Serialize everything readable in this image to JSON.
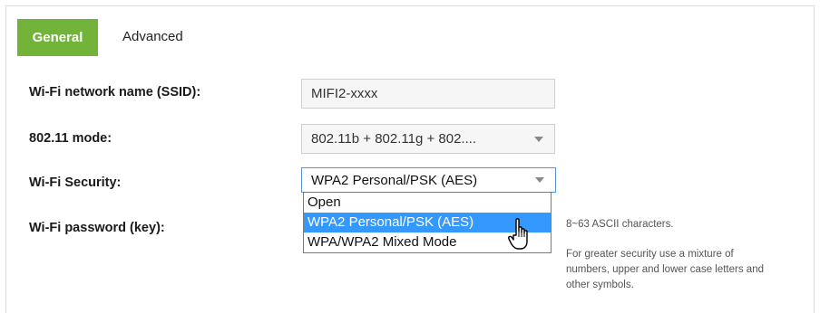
{
  "tabs": [
    {
      "label": "General",
      "active": true
    },
    {
      "label": "Advanced",
      "active": false
    }
  ],
  "fields": {
    "ssid": {
      "label": "Wi-Fi network name (SSID):",
      "value": "MIFI2-xxxx"
    },
    "mode": {
      "label": "802.11 mode:",
      "value": "802.11b + 802.11g + 802...."
    },
    "security": {
      "label": "Wi-Fi Security:",
      "value": "WPA2 Personal/PSK (AES)",
      "options": [
        "Open",
        "WPA2 Personal/PSK (AES)",
        "WPA/WPA2 Mixed Mode"
      ],
      "highlighted": "WPA2 Personal/PSK (AES)"
    },
    "password": {
      "label": "Wi-Fi password (key):"
    }
  },
  "help": {
    "line1": "8~63 ASCII characters.",
    "line2": "For greater security use a mixture of",
    "line3": "numbers, upper and lower case letters and",
    "line4": "other symbols."
  },
  "colors": {
    "accent": "#72b33a",
    "highlight": "#3399ff"
  },
  "icons": {
    "cursor": "hand-pointer-icon"
  }
}
